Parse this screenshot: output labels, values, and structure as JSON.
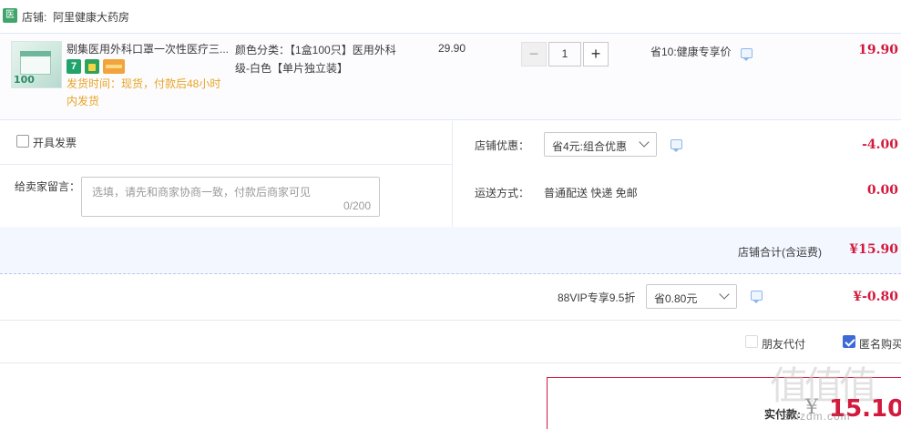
{
  "shop": {
    "badge": "医",
    "label": "店铺:",
    "name": "阿里健康大药房"
  },
  "item": {
    "title": "剔集医用外科口罩一次性医疗三...",
    "thumb_count": "100",
    "tag_seven": "7",
    "ship_note": "发货时间：现货，付款后48小时内发货",
    "spec": "颜色分类：【1盒100只】医用外科级-白色【单片独立装】",
    "unit_price": "29.90",
    "quantity": "1",
    "minus": "−",
    "plus": "+",
    "promo": "省10:健康专享价",
    "total": "19.90"
  },
  "options": {
    "invoice_label": "开具发票",
    "message_label": "给卖家留言：",
    "message_placeholder": "选填，请先和商家协商一致，付款后商家可见",
    "message_count": "0/200",
    "shop_discount_label": "店铺优惠：",
    "shop_discount_value": "省4元:组合优惠",
    "shop_discount_amount": "-4.00",
    "shipping_label": "运送方式：",
    "shipping_value": "普通配送 快递 免邮",
    "shipping_amount": "0.00"
  },
  "subtotal": {
    "label": "店铺合计(含运费)",
    "amount": "¥15.90"
  },
  "vip": {
    "label": "88VIP专享9.5折",
    "select_value": "省0.80元",
    "amount": "¥-0.80"
  },
  "pay_options": {
    "friend_pay": "朋友代付",
    "anonymous": "匿名购买"
  },
  "final": {
    "label": "实付款:",
    "yen": "¥",
    "amount": "15.10"
  },
  "watermark": {
    "chars": "值值值",
    "url": "smzdm.com"
  },
  "colors": {
    "accent_red": "#d3193c",
    "link_blue": "#3d6bd6",
    "note_orange": "#e8a424"
  }
}
